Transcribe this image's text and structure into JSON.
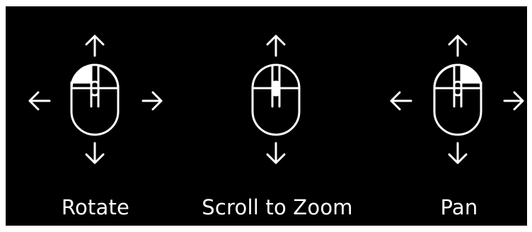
{
  "controls": [
    {
      "id": "rotate",
      "label": "Rotate",
      "icon": "mouse-left-button-icon",
      "highlight": "left-button"
    },
    {
      "id": "zoom",
      "label": "Scroll to Zoom",
      "icon": "mouse-scroll-wheel-icon",
      "highlight": "scroll-wheel"
    },
    {
      "id": "pan",
      "label": "Pan",
      "icon": "mouse-right-button-icon",
      "highlight": "right-button"
    }
  ],
  "colors": {
    "background": "#000000",
    "foreground": "#ffffff"
  }
}
